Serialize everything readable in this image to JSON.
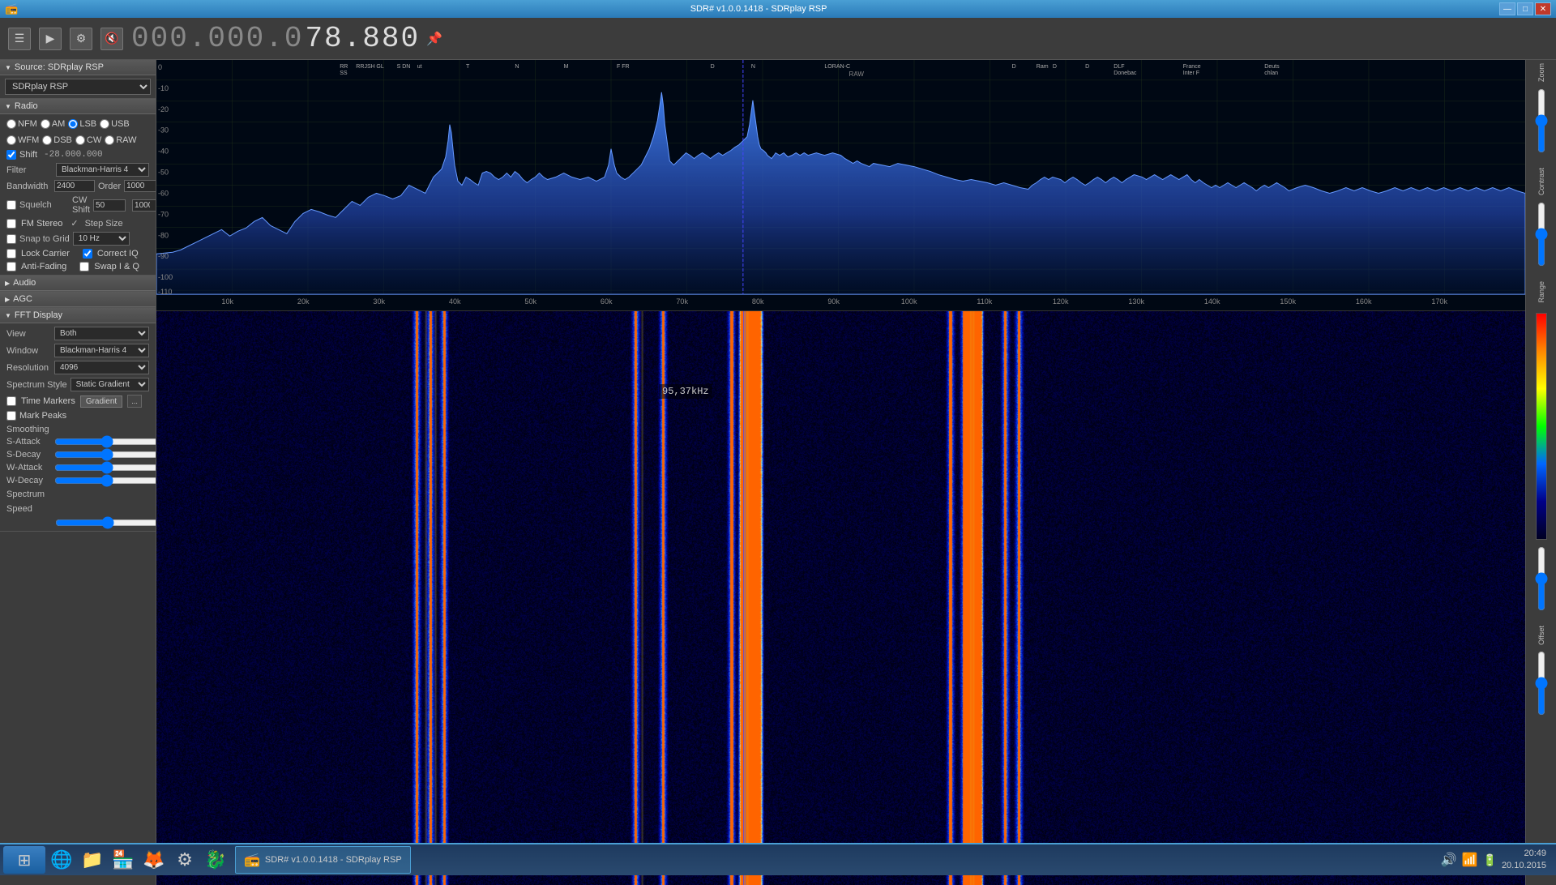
{
  "titlebar": {
    "title": "SDR# v1.0.0.1418 - SDRplay RSP",
    "app_icon": "📻",
    "min_btn": "—",
    "max_btn": "□",
    "close_btn": "✕"
  },
  "toolbar": {
    "menu_icon": "☰",
    "play_icon": "▶",
    "settings_icon": "⚙",
    "mute_icon": "🔇",
    "frequency": "000.000.078.880",
    "freq_parts": {
      "dim": "000.000.0",
      "bright": "78.880"
    },
    "pin_icon": "📌"
  },
  "sidebar": {
    "source_section": "Source: SDRplay RSP",
    "source_option": "SDRplay RSP",
    "radio_section": "Radio",
    "modes": [
      "NFM",
      "AM",
      "LSB",
      "USB",
      "WFM",
      "DSB",
      "CW",
      "RAW"
    ],
    "selected_mode": "LSB",
    "shift_checked": true,
    "shift_value": "-28.000.000",
    "filter_label": "Filter",
    "filter_value": "Blackman-Harris 4",
    "bandwidth_label": "Bandwidth",
    "bandwidth_value": "2400",
    "order_label": "Order",
    "order_value": "1000",
    "squelch_label": "Squelch",
    "squelch_checked": false,
    "squelch_value": "50",
    "squelch_max": "1000",
    "cw_shift_label": "CW Shift",
    "fm_stereo_checked": false,
    "fm_stereo_label": "FM Stereo",
    "step_size_label": "Step Size",
    "step_size_value": "10 Hz",
    "snap_to_grid_label": "Snap to Grid",
    "snap_checked": false,
    "lock_carrier_label": "Lock Carrier",
    "lock_carrier_checked": false,
    "correct_iq_label": "Correct IQ",
    "correct_iq_checked": true,
    "anti_fading_label": "Anti-Fading",
    "anti_fading_checked": false,
    "swap_iq_label": "Swap I & Q",
    "swap_iq_checked": false,
    "audio_section": "Audio",
    "agc_section": "AGC",
    "fft_section": "FFT Display",
    "view_label": "View",
    "view_value": "Both",
    "window_label": "Window",
    "window_value": "Blackman-Harris 4",
    "resolution_label": "Resolution",
    "resolution_value": "4096",
    "spectrum_style_label": "Spectrum Style",
    "spectrum_style_value": "Static Gradient",
    "time_markers_label": "Time Markers",
    "time_markers_checked": false,
    "gradient_btn": "Gradient",
    "mark_peaks_label": "Mark Peaks",
    "mark_peaks_checked": false,
    "smoothing_label": "Smoothing",
    "s_attack_label": "S-Attack",
    "s_decay_label": "S-Decay",
    "w_attack_label": "W-Attack",
    "w_decay_label": "W-Decay",
    "spectrum_label": "Spectrum",
    "speed_label": "Speed"
  },
  "spectrum": {
    "db_labels": [
      "0",
      "-10",
      "-20",
      "-30",
      "-40",
      "-50",
      "-60",
      "-70",
      "-80",
      "-90",
      "-100",
      "-110"
    ],
    "freq_labels": [
      "10k",
      "20k",
      "30k",
      "40k",
      "50k",
      "60k",
      "70k",
      "80k",
      "90k",
      "100k",
      "110k",
      "120k",
      "130k",
      "140k",
      "150k",
      "160k",
      "170k"
    ],
    "waterfall_freq_label": "95,37kHz"
  },
  "right_panel": {
    "zoom_label": "Zoom",
    "contrast_label": "Contrast",
    "range_label": "Range",
    "offset_label": "Offset"
  },
  "taskbar": {
    "start_icon": "⊞",
    "icons": [
      "🌐",
      "📁",
      "🏪",
      "🦊",
      "⚙",
      "🐉"
    ],
    "time": "20:49",
    "date": "20.10.2015",
    "sys_icons": [
      "🔊",
      "📶",
      "🔋"
    ]
  }
}
